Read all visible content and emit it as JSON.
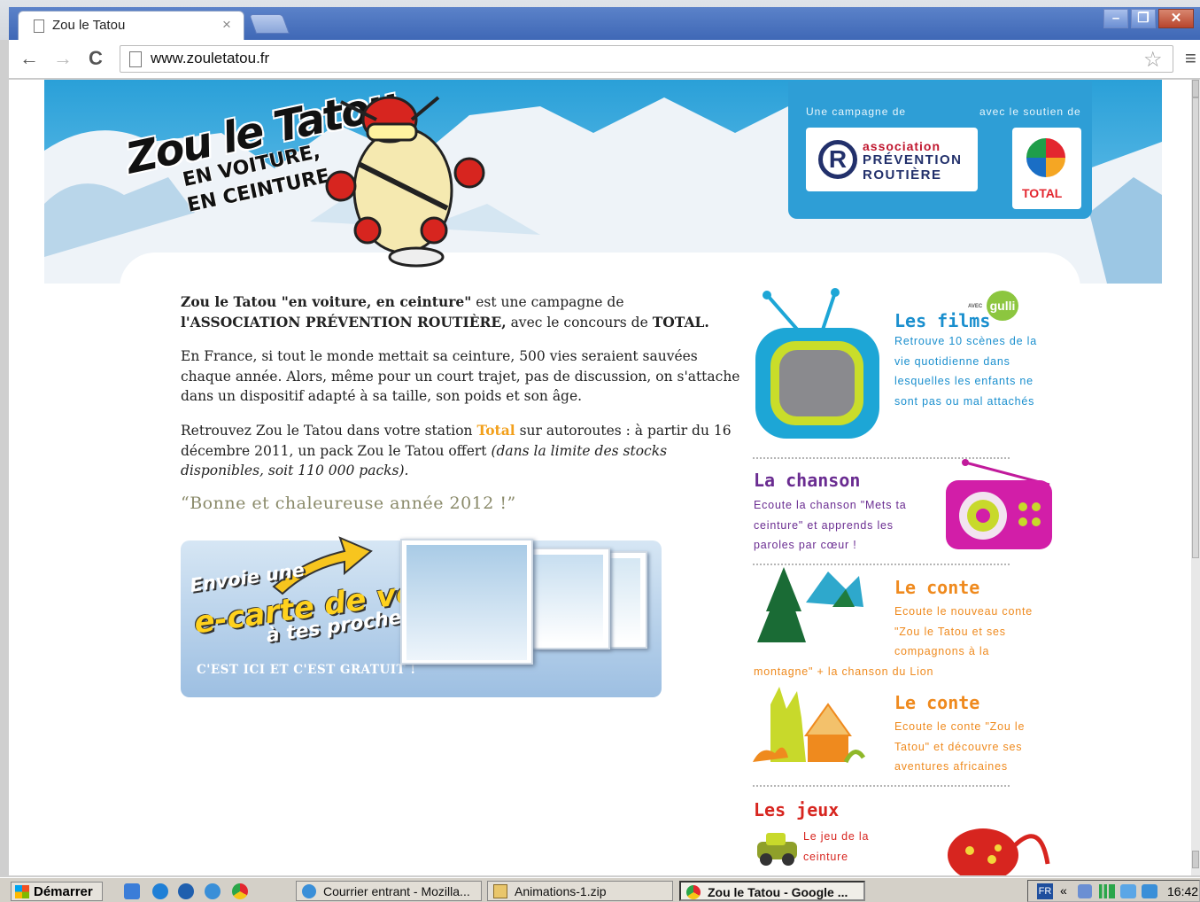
{
  "browser": {
    "tab_title": "Zou le Tatou",
    "tab_close": "×",
    "url": "www.zouletatou.fr",
    "back": "←",
    "forward": "→",
    "reload": "C",
    "star": "☆",
    "menu": "≡",
    "win_min": "–",
    "win_max": "❐",
    "win_close": "✕"
  },
  "site": {
    "logo": {
      "title": "Zou le Tatou",
      "sub1": "EN VOITURE,",
      "sub2": "EN CEINTURE"
    },
    "partners": {
      "label_left": "Une campagne de",
      "label_right": "avec le soutien de",
      "apr_line1": "association",
      "apr_line2": "PRÉVENTION",
      "apr_line3": "ROUTIÈRE",
      "total": "TOTAL"
    },
    "intro": {
      "p1_bold1": "Zou le Tatou \"en voiture, en ceinture\"",
      "p1_text1": " est une campagne de ",
      "p1_bold2": "l'ASSOCIATION PRÉVENTION ROUTIÈRE,",
      "p1_text2": " avec le concours de ",
      "p1_bold3": "TOTAL.",
      "p2": "En France, si tout le monde mettait sa ceinture, 500 vies seraient sauvées chaque année. Alors, même pour un court trajet, pas de discussion, on s'attache dans un dispositif adapté à sa taille, son poids et son âge.",
      "p3_text1": "Retrouvez Zou le Tatou dans votre station ",
      "p3_total": "Total",
      "p3_text2": " sur autoroutes : à partir du 16 décembre 2011, un pack Zou le Tatou offert ",
      "p3_italic": "(dans la limite des stocks disponibles, soit 110 000 packs).",
      "wish": "“Bonne et chaleureuse année 2012 !”"
    },
    "ecard": {
      "line1": "Envoie une",
      "line2": "e-carte de vœux",
      "line3": "à tes proches !",
      "cta": "C'EST ICI ET C'EST GRATUIT !"
    },
    "sections": [
      {
        "title": "Les films",
        "badge": "gulli",
        "badge_pre": "AVEC",
        "desc": [
          "Retrouve 10 scènes de la",
          "vie quotidienne dans",
          "lesquelles les enfants ne",
          "sont pas ou mal attachés"
        ],
        "color": "#1a8fce"
      },
      {
        "title": "La chanson",
        "desc": [
          "Ecoute la chanson \"Mets ta",
          "ceinture\" et apprends les",
          "paroles par cœur !"
        ],
        "color": "#6a2c91"
      },
      {
        "title": "Le conte",
        "desc": [
          "Ecoute le nouveau conte",
          "\"Zou le Tatou et ses",
          "compagnons à la"
        ],
        "desc_tail": "montagne\" + la chanson du Lion",
        "color": "#ef8a1e"
      },
      {
        "title": "Le conte",
        "desc": [
          "Ecoute le conte \"Zou le",
          "Tatou\" et découvre ses",
          "aventures africaines"
        ],
        "color": "#ef8a1e"
      },
      {
        "title": "Les jeux",
        "desc": [
          "Le jeu de la",
          "ceinture"
        ],
        "color": "#d7251f"
      }
    ]
  },
  "taskbar": {
    "start": "Démarrer",
    "items": [
      "Courrier entrant - Mozilla...",
      "Animations-1.zip",
      "Zou le Tatou - Google ..."
    ],
    "lang": "FR",
    "chevron": "«",
    "clock": "16:42"
  }
}
